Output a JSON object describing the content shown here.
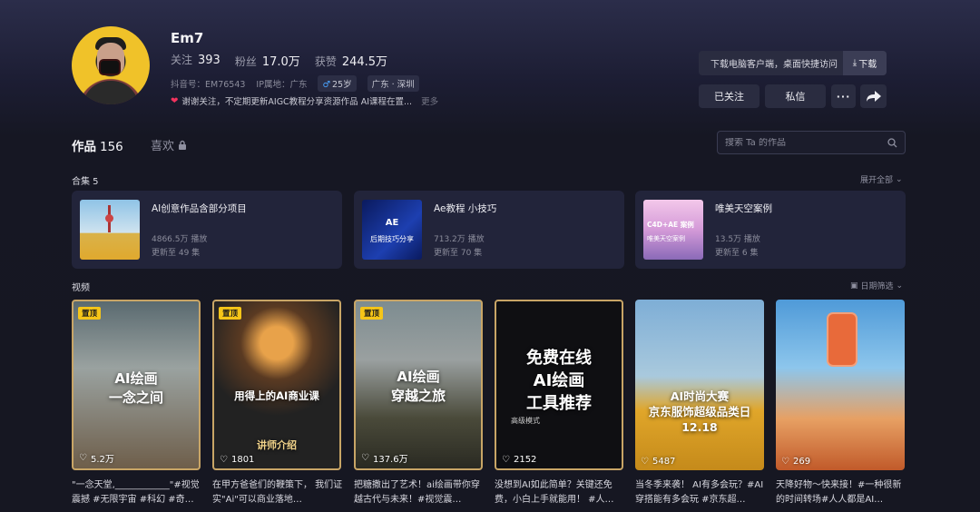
{
  "profile": {
    "name": "Em7",
    "stats": [
      {
        "label": "关注",
        "value": "393"
      },
      {
        "label": "粉丝",
        "value": "17.0万"
      },
      {
        "label": "获赞",
        "value": "244.5万"
      }
    ],
    "douyin_id": "抖音号：EM76543",
    "ip": "IP属地：广东",
    "age": "25岁",
    "location": "广东 · 深圳",
    "bio": "谢谢关注，不定期更新AIGC教程分享资源作品 AI课程在置...",
    "bio_more": "更多"
  },
  "download": {
    "text": "下载电脑客户端，桌面快捷访问",
    "button": "下载"
  },
  "actions": {
    "follow": "已关注",
    "message": "私信",
    "more": "···"
  },
  "tabs": {
    "works": "作品",
    "works_count": "156",
    "likes": "喜欢"
  },
  "search": {
    "placeholder": "搜索 Ta 的作品"
  },
  "collections": {
    "title": "合集 5",
    "expand": "展开全部",
    "items": [
      {
        "title": "AI创意作品含部分项目",
        "plays": "4866.5万 播放",
        "updated": "更新至 49 集"
      },
      {
        "title": "Ae教程 小技巧",
        "plays": "713.2万 播放",
        "updated": "更新至 70 集",
        "thumb_text_1": "AE",
        "thumb_text_2": "后期技巧分享"
      },
      {
        "title": "唯美天空案例",
        "plays": "13.5万 播放",
        "updated": "更新至 6 集",
        "thumb_text_1": "C4D+AE 案例",
        "thumb_text_2": "唯美天空案例"
      }
    ]
  },
  "videos": {
    "title": "视频",
    "filter": "日期筛选",
    "pinned_label": "置顶",
    "items": [
      {
        "pinned": true,
        "likes": "5.2万",
        "overlay": "AI绘画\n一念之间",
        "caption": "\"一念天堂,____________\"#视觉震撼 #无限宇宙 #科幻 #奇…"
      },
      {
        "pinned": true,
        "likes": "1801",
        "overlay": "用得上的AI商业课",
        "overlay2": "讲师介绍",
        "caption": "在甲方爸爸们的鞭策下， 我们证实\"Ai\"可以商业落地…"
      },
      {
        "pinned": true,
        "likes": "137.6万",
        "overlay": "AI绘画\n穿越之旅",
        "caption": "把糖撒出了艺术！ai绘画带你穿越古代与未来！#视觉震…"
      },
      {
        "pinned": false,
        "likes": "2152",
        "overlay": "免费在线\nAI绘画\n工具推荐",
        "overlay2": "高级模式",
        "caption": "没想到AI如此简单？关键还免费，小白上手就能用！ #人…"
      },
      {
        "pinned": false,
        "likes": "5487",
        "overlay": "AI时尚大赛\n京东服饰超级品类日\n12.18",
        "caption": "当冬季来袭！ AI有多会玩？#AI穿搭能有多会玩 #京东超…"
      },
      {
        "pinned": false,
        "likes": "269",
        "overlay": "",
        "caption": "天降好物～快来接！#一种很新的时间转场#人人都是AI…"
      }
    ]
  }
}
